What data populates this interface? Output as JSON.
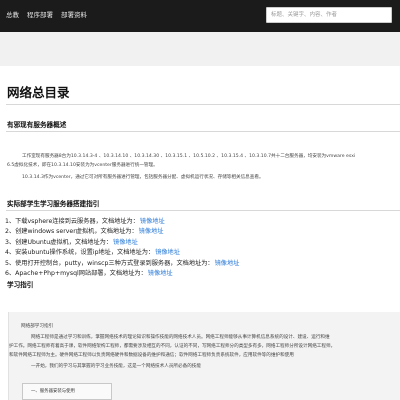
{
  "nav": {
    "items": [
      "总教",
      "程序部署",
      "部署资料"
    ]
  },
  "search": {
    "placeholder": "标题、关键字、内容、作者"
  },
  "page": {
    "title": "网络总目录"
  },
  "section1": {
    "heading": "有邪现有服务器概述",
    "lines": [
      "工作室现有服务器8台为10.3.14.3-4 、10.3.14.10 、10.3.14.30 、10.3.15.1 、10.5.10.2 、10.3.15.4 、10.3.10.7共十二台服务器，均安装为vmware esxi",
      "6.5虚拟化技术，即在10.3.14.10安装为为vcenter服务器进行统一管理。",
      "10.3.14.3作为vcenter，通过它可对所有服务器进行管理，包括服务器分配、虚拟机运行状况、存储等相关信息查看。"
    ]
  },
  "section2": {
    "heading": "实际部学生学习服务器搭建指引",
    "items": [
      {
        "num": "1、",
        "text": "下载vsphere连接到云服务器，文档地址为：",
        "link": "镜像地址"
      },
      {
        "num": "2、",
        "text": "创建windows server虚拟机，文档地址为：",
        "link": "镜像地址"
      },
      {
        "num": "3、",
        "text": "创建Ubuntu虚拟机，文档地址为：",
        "link": "镜像地址"
      },
      {
        "num": "4、",
        "text": "安装ubuntu操作系统，设置ip地址，文档地址为：",
        "link": "镜像地址"
      },
      {
        "num": "5、",
        "text": "使用打开控制台，putty，winscp三种方式登录到服务器，文档地址为：",
        "link": "镜像地址"
      },
      {
        "num": "6、",
        "text": "Apache+Php+mysql网站部署，文档地址为：",
        "link": "镜像地址"
      }
    ]
  },
  "section3": {
    "heading": "学习指引",
    "box_title": "网络部学习指引",
    "lines": [
      "网络工程师是通过学习和训练，掌握网络技术的理论知识和操作技能的网络技术人员。网络工程师能够从事计算机信息系统的设计、建设、运行和维",
      "护工作。网络工程师有着高于课，软件网络架构工程师，都需要涉及相互的不同，认证的不同，写网络工程师分的类型多有多，网络工程师分所设计网络工程师，",
      "和软件网络工程师为主。硬件网络工程师以负责网络硬件和数据设备的维护和通信；软件网络工程师负责系统软件，应用软件等的维护和使用",
      "一开始，我们的学习与其掌握的学习业务技能，这是一个网络技术人员所必备的技能"
    ],
    "sub_item": "一、服务器安装与使用"
  }
}
